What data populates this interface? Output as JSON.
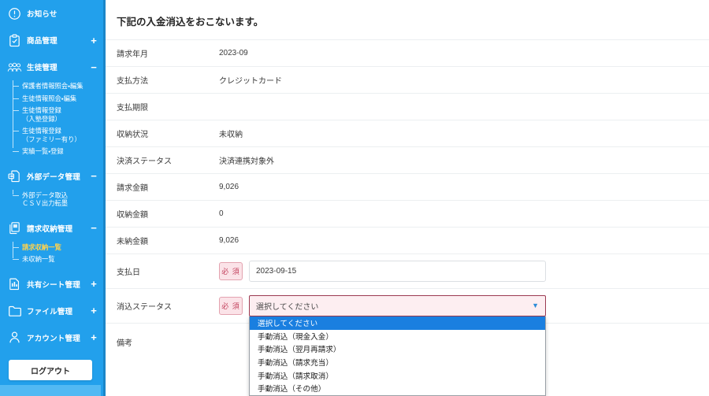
{
  "sidebar": {
    "accent_color": "#22a0ec",
    "active_color": "#ffd34d",
    "items": [
      {
        "label": "お知らせ",
        "icon": "exclamation-circle-icon",
        "toggle": ""
      },
      {
        "label": "商品管理",
        "icon": "clipboard-check-icon",
        "toggle": "+"
      },
      {
        "label": "生徒管理",
        "icon": "users-icon",
        "toggle": "−",
        "children": [
          {
            "label": "保護者情報照会・編集",
            "active": false
          },
          {
            "label": "生徒情報照会・編集",
            "active": false
          },
          {
            "label": "生徒情報登録\n（入塾登録）",
            "active": false
          },
          {
            "label": "生徒情報登録\n（ファミリー有り）",
            "active": false
          },
          {
            "label": "実績一覧・登録",
            "active": false
          }
        ]
      },
      {
        "label": "外部データ管理",
        "icon": "file-import-icon",
        "toggle": "−",
        "children": [
          {
            "label": "外部データ取込\nＣＳＶ出力転墨",
            "active": false
          }
        ]
      },
      {
        "label": "請求収納管理",
        "icon": "documents-icon",
        "toggle": "−",
        "children": [
          {
            "label": "請求収納一覧",
            "active": true
          },
          {
            "label": "未収納一覧",
            "active": false
          }
        ]
      },
      {
        "label": "共有シート管理",
        "icon": "sheet-icon",
        "toggle": "+"
      },
      {
        "label": "ファイル管理",
        "icon": "folder-icon",
        "toggle": "+"
      },
      {
        "label": "アカウント管理",
        "icon": "user-icon",
        "toggle": "+"
      }
    ],
    "logout_label": "ログアウト"
  },
  "main": {
    "page_title": "下記の入金消込をおこないます。",
    "rows": [
      {
        "label": "請求年月",
        "value": "2023-09"
      },
      {
        "label": "支払方法",
        "value": "クレジットカード"
      },
      {
        "label": "支払期限",
        "value": ""
      },
      {
        "label": "収納状況",
        "value": "未収納"
      },
      {
        "label": "決済ステータス",
        "value": "決済連携対象外"
      },
      {
        "label": "請求金額",
        "value": "9,026"
      },
      {
        "label": "収納金額",
        "value": "0"
      },
      {
        "label": "未納金額",
        "value": "9,026"
      }
    ],
    "payment_date": {
      "label": "支払日",
      "required_badge": "必 須",
      "value": "2023-09-15"
    },
    "clearing_status": {
      "label": "消込ステータス",
      "required_badge": "必 須",
      "selected": "選択してください",
      "caret_icon": "chevron-down-icon",
      "options": [
        "選択してください",
        "手動消込（現金入金）",
        "手動消込（翌月再請求）",
        "手動消込（請求充当）",
        "手動消込（請求取消）",
        "手動消込（その他）"
      ]
    },
    "remarks": {
      "label": "備考",
      "value": ""
    }
  }
}
